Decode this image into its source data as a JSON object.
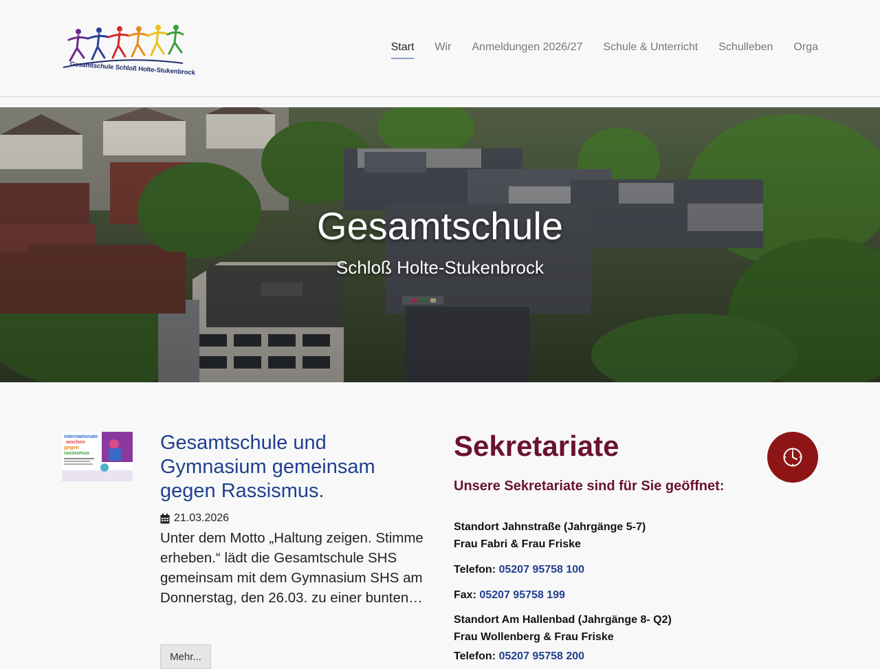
{
  "header": {
    "logo_text": "Gesamtschule Schloß Holte-Stukenbrock",
    "nav": [
      {
        "label": "Start",
        "active": true
      },
      {
        "label": "Wir"
      },
      {
        "label": "Anmeldungen 2026/27"
      },
      {
        "label": "Schule & Unterricht"
      },
      {
        "label": "Schulleben"
      },
      {
        "label": "Orga"
      }
    ]
  },
  "hero": {
    "title": "Gesamtschule",
    "subtitle": "Schloß Holte-Stukenbrock"
  },
  "news": {
    "thumb_lines": [
      "internationale",
      "wochen",
      "gegen",
      "rassismus"
    ],
    "title": "Gesamtschule und Gymnasium gemeinsam gegen Rassismus.",
    "date_icon": "calendar-icon",
    "date": "21.03.2026",
    "excerpt": "Unter dem Motto „Haltung zeigen. Stimme erheben.“ lädt die Gesamtschule SHS gemeinsam mit dem Gymnasium SHS am Donnerstag, den 26.03.  zu einer bunten…",
    "more_label": "Mehr..."
  },
  "secretariat": {
    "title": "Sekretariate",
    "subtitle": "Unsere Sekretariate sind für Sie geöffnet:",
    "clock_icon": "clock-icon",
    "loc1_title": "Standort Jahnstraße (Jahrgänge 5-7)",
    "loc1_staff": "Frau Fabri & Frau Friske",
    "phone_label": "Telefon:",
    "loc1_phone": "05207 95758 100",
    "fax_label": "Fax:",
    "loc1_fax": "05207 95758 199",
    "loc2_title": "Standort Am Hallenbad (Jahrgänge 8- Q2)",
    "loc2_staff": "Frau Wollenberg & Frau Friske",
    "loc2_phone": "05207 95758 200"
  },
  "colors": {
    "accent_blue": "#1f3f8f",
    "sek_red": "#6a1230",
    "clock_bg": "#8e1515"
  }
}
